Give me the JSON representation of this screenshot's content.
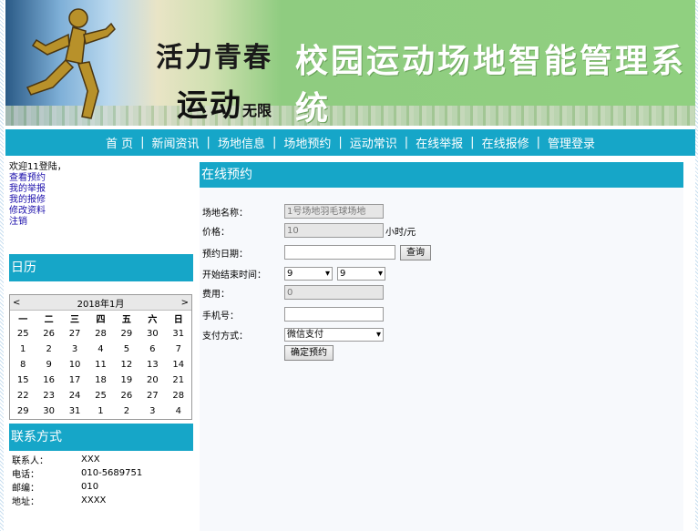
{
  "banner": {
    "slogan_line1": "活力青春",
    "slogan_line2": "运动",
    "slogan_suffix": "无限",
    "system_title": "校园运动场地智能管理系统"
  },
  "nav": {
    "items": [
      "首 页",
      "新闻资讯",
      "场地信息",
      "场地预约",
      "运动常识",
      "在线举报",
      "在线报修",
      "管理登录"
    ]
  },
  "sidebar": {
    "welcome": "欢迎11登陆，",
    "links": [
      "查看预约",
      "我的举报",
      "我的报修",
      "修改资料",
      "注销"
    ],
    "calendar_title": "日历",
    "calendar": {
      "month_label": "2018年1月",
      "prev": "<",
      "next": ">",
      "weekdays": [
        "一",
        "二",
        "三",
        "四",
        "五",
        "六",
        "日"
      ],
      "weeks": [
        [
          "25",
          "26",
          "27",
          "28",
          "29",
          "30",
          "31"
        ],
        [
          "1",
          "2",
          "3",
          "4",
          "5",
          "6",
          "7"
        ],
        [
          "8",
          "9",
          "10",
          "11",
          "12",
          "13",
          "14"
        ],
        [
          "15",
          "16",
          "17",
          "18",
          "19",
          "20",
          "21"
        ],
        [
          "22",
          "23",
          "24",
          "25",
          "26",
          "27",
          "28"
        ],
        [
          "29",
          "30",
          "31",
          "1",
          "2",
          "3",
          "4"
        ]
      ]
    },
    "contact_title": "联系方式",
    "contact": [
      {
        "label": "联系人：",
        "value": "XXX"
      },
      {
        "label": "电话：",
        "value": "010-5689751"
      },
      {
        "label": "邮编：",
        "value": "010"
      },
      {
        "label": "地址：",
        "value": "XXXX"
      }
    ]
  },
  "main": {
    "title": "在线预约",
    "venue_label": "场地名称：",
    "venue_value": "1号场地羽毛球场地",
    "price_label": "价格：",
    "price_value": "10",
    "price_unit": "小时/元",
    "date_label": "预约日期：",
    "date_value": "",
    "query_button": "查询",
    "time_label": "开始结束时间：",
    "start_time": "9",
    "end_time": "9",
    "fee_label": "费用：",
    "fee_value": "0",
    "phone_label": "手机号：",
    "phone_value": "",
    "pay_label": "支付方式：",
    "pay_value": "微信支付",
    "submit_button": "确定预约"
  },
  "colors": {
    "accent": "#16a6c8",
    "banner_green": "#90d080"
  }
}
